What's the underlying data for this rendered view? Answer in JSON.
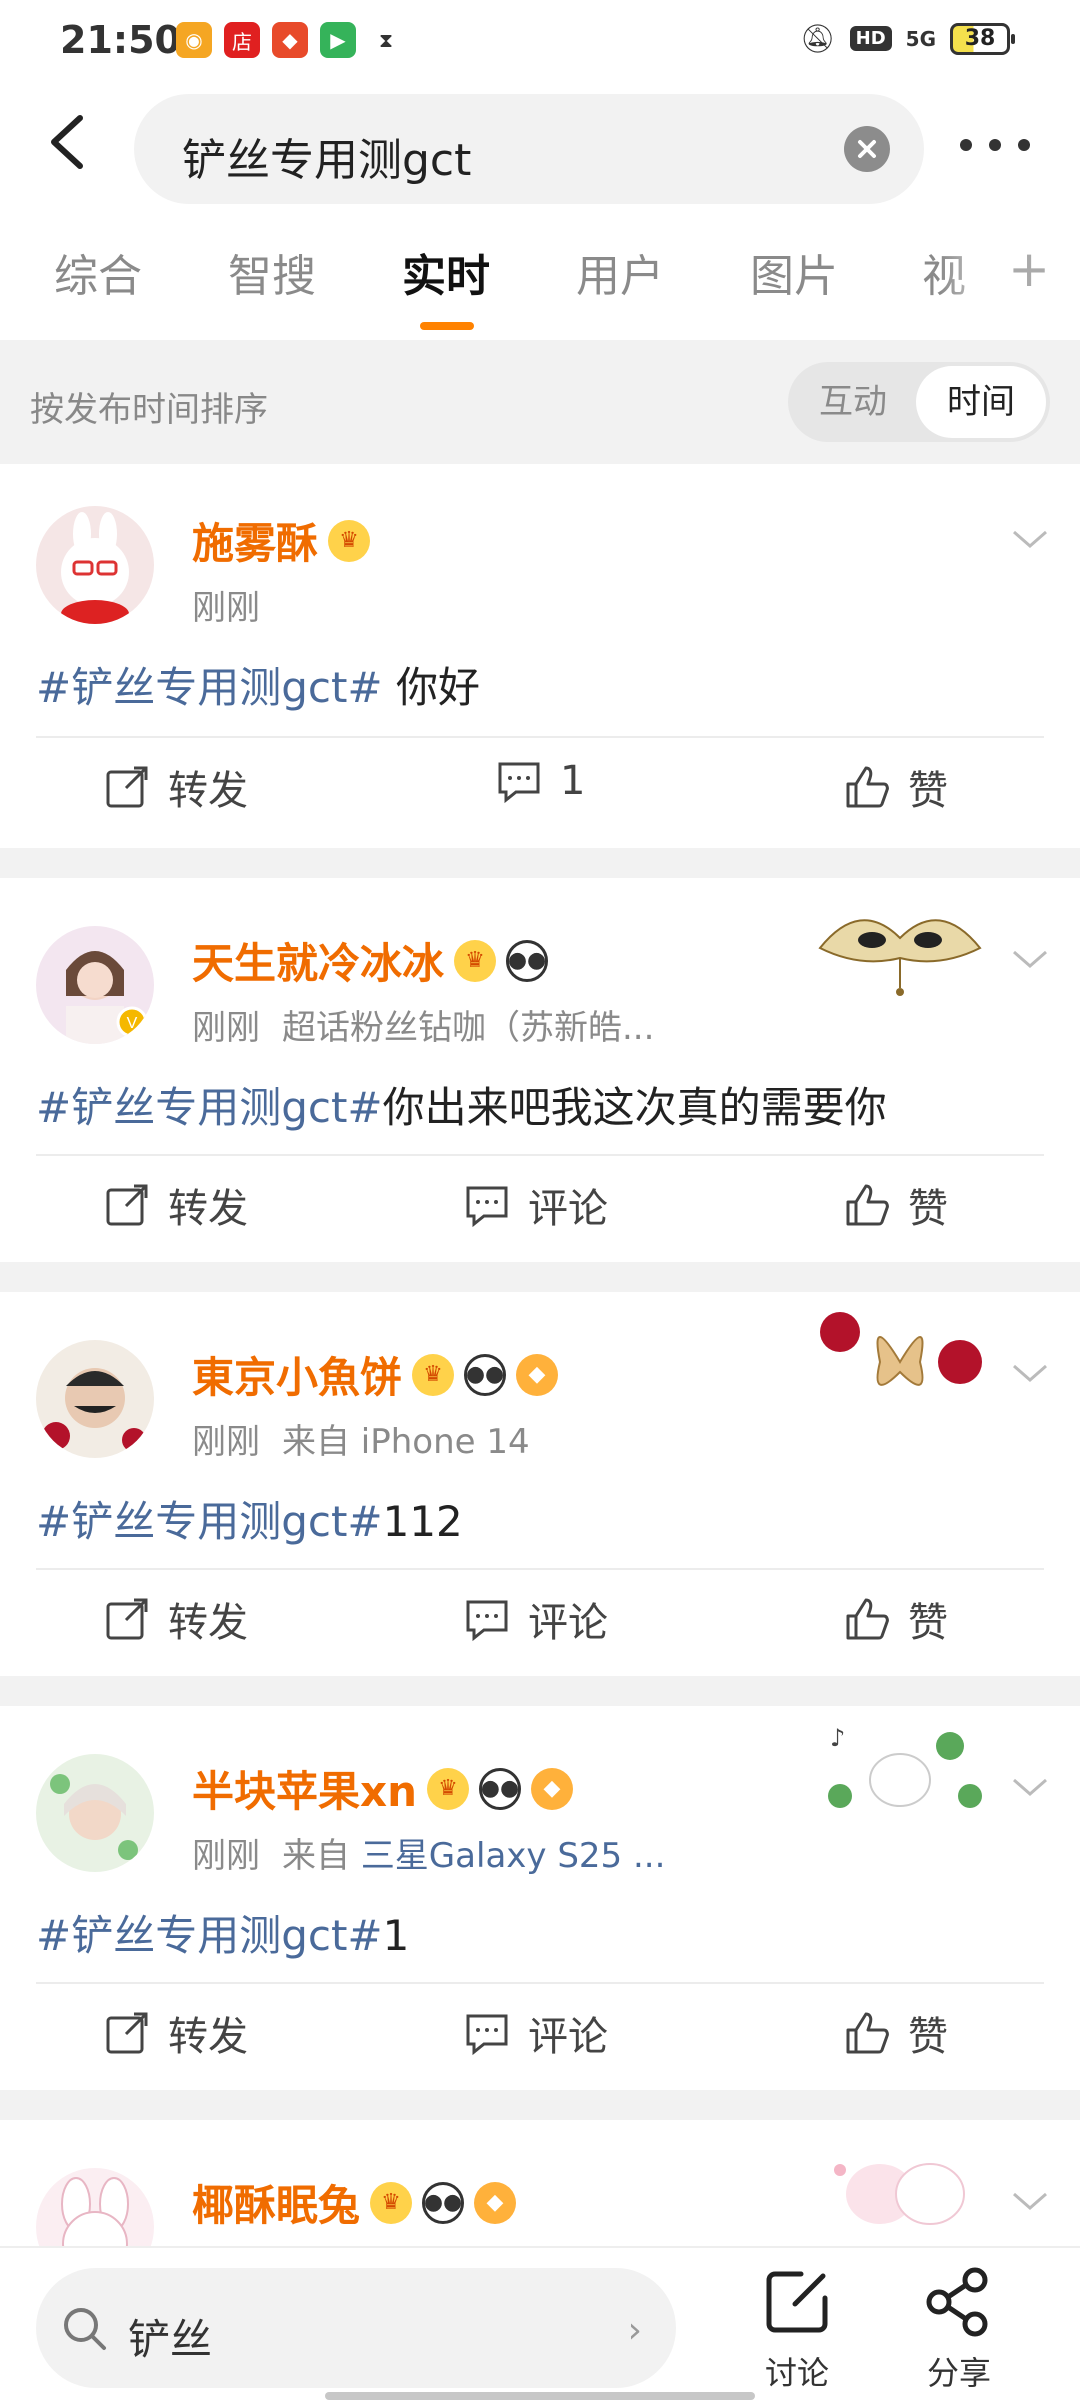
{
  "status_bar": {
    "time": "21:50",
    "battery": "38",
    "network": "5G",
    "hd": "HD"
  },
  "header": {
    "search_query": "铲丝专用测gct"
  },
  "tabs": [
    {
      "label": "综合",
      "active": false
    },
    {
      "label": "智搜",
      "active": false
    },
    {
      "label": "实时",
      "active": true
    },
    {
      "label": "用户",
      "active": false
    },
    {
      "label": "图片",
      "active": false
    },
    {
      "label": "视",
      "active": false
    }
  ],
  "sort_bar": {
    "label": "按发布时间排序",
    "option_interact": "互动",
    "option_time": "时间"
  },
  "posts": [
    {
      "author": "施雾酥",
      "time": "刚刚",
      "source": "",
      "tag": "#铲丝专用测gct#",
      "text": " 你好",
      "repost": "转发",
      "comment": "1",
      "like": "赞"
    },
    {
      "author": "天生就冷冰冰",
      "time": "刚刚",
      "source": "超话粉丝钻咖（苏新皓...",
      "tag": "#铲丝专用测gct#",
      "text": "你出来吧我这次真的需要你",
      "repost": "转发",
      "comment": "评论",
      "like": "赞"
    },
    {
      "author": "東京小魚饼",
      "time": "刚刚",
      "source": "来自 iPhone 14",
      "tag": "#铲丝专用测gct#",
      "text": "112",
      "repost": "转发",
      "comment": "评论",
      "like": "赞"
    },
    {
      "author": "半块苹果xn",
      "time": "刚刚",
      "source_prefix": "来自 ",
      "source": "三星Galaxy S25 ...",
      "tag": "#铲丝专用测gct#",
      "text": "1",
      "repost": "转发",
      "comment": "评论",
      "like": "赞"
    },
    {
      "author": "椰酥眠兔",
      "time": "",
      "source": "",
      "tag": "",
      "text": ""
    }
  ],
  "bottom_bar": {
    "search_text": "铲丝",
    "discuss": "讨论",
    "share": "分享"
  },
  "colors": {
    "accent_orange": "#ff8200",
    "author_orange": "#f06c00",
    "tag_blue": "#4a6a9a"
  }
}
